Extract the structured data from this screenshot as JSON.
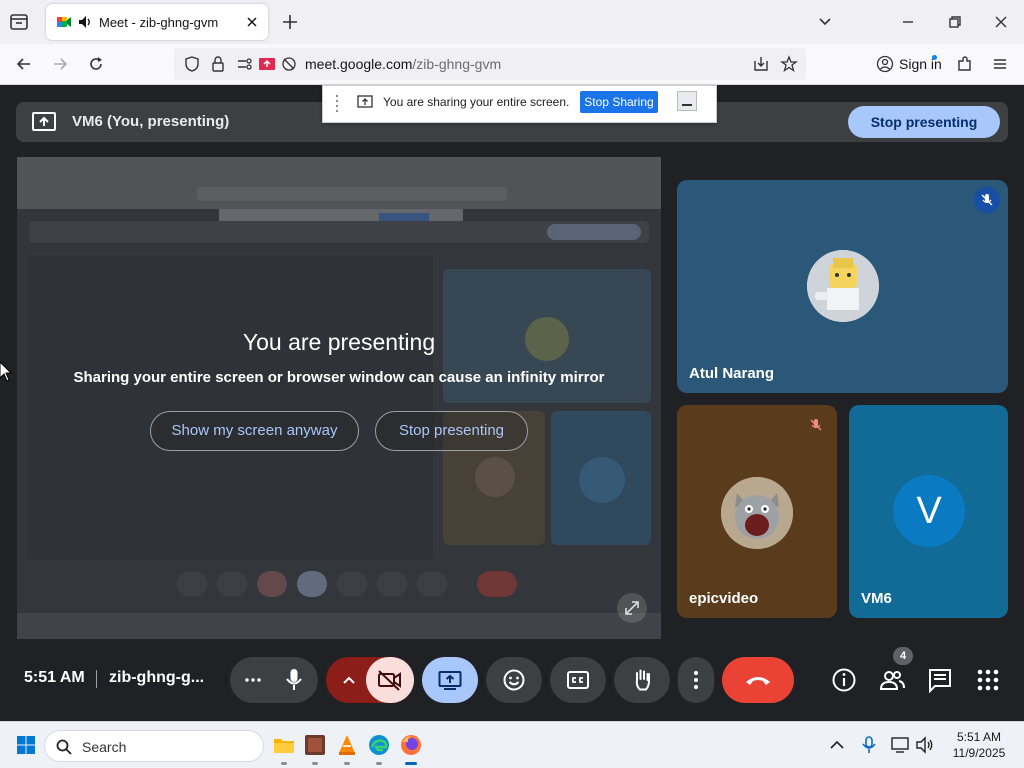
{
  "browser": {
    "tab_title": "Meet - zib-ghng-gvm",
    "url_domain": "meet.google.com",
    "url_path": "/zib-ghng-gvm",
    "sign_in_label": "Sign in"
  },
  "share_notice": {
    "message": "You are sharing your entire screen.",
    "stop_label": "Stop Sharing"
  },
  "presenting_bar": {
    "label": "VM6 (You, presenting)",
    "stop_label": "Stop presenting"
  },
  "self_tile": {
    "title": "You are presenting",
    "subtitle": "Sharing your entire screen or browser window can cause an infinity mirror",
    "show_anyway_label": "Show my screen anyway",
    "stop_label": "Stop presenting"
  },
  "participants": [
    {
      "name": "Atul Narang",
      "muted": true
    },
    {
      "name": "epicvideo",
      "muted": true
    },
    {
      "name": "VM6",
      "avatar_letter": "V"
    }
  ],
  "toolbar": {
    "time": "5:51 AM",
    "meeting_code": "zib-ghng-g...",
    "people_count": "4"
  },
  "taskbar": {
    "search_label": "Search",
    "clock_time": "5:51 AM",
    "clock_date": "11/9/2025"
  },
  "colors": {
    "meet_bg": "#202124",
    "accent_blue": "#a8c7fa",
    "end_call_red": "#ea4335",
    "camera_off_pink": "#f9dedc"
  }
}
